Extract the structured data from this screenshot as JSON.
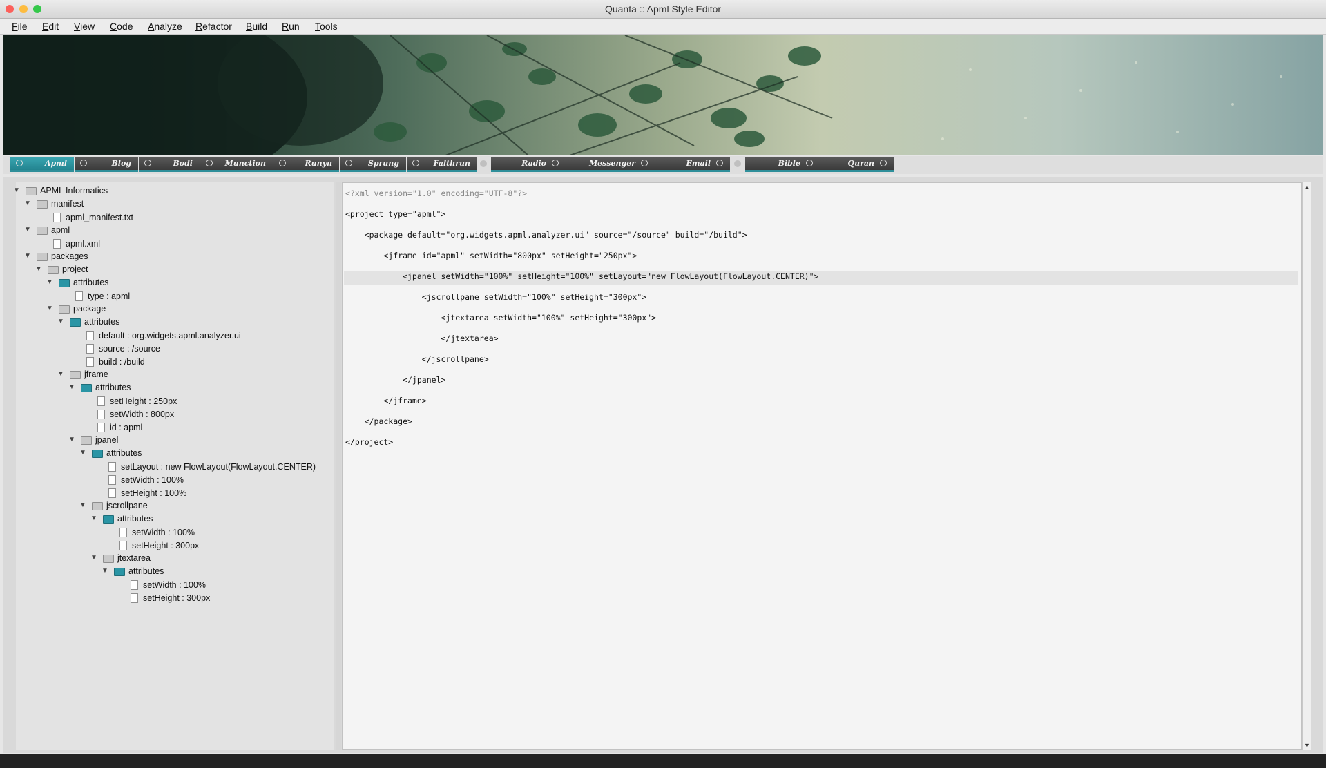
{
  "window": {
    "title": "Quanta :: Apml Style Editor",
    "traffic_lights": {
      "close": "#fc605b",
      "minimize": "#fdbc40",
      "zoom": "#34c84a"
    }
  },
  "menubar": {
    "items": [
      {
        "id": "file",
        "mnemonic": "F",
        "rest": "ile"
      },
      {
        "id": "edit",
        "mnemonic": "E",
        "rest": "dit"
      },
      {
        "id": "view",
        "mnemonic": "V",
        "rest": "iew"
      },
      {
        "id": "code",
        "mnemonic": "C",
        "rest": "ode"
      },
      {
        "id": "analyze",
        "mnemonic": "A",
        "rest": "nalyze"
      },
      {
        "id": "refactor",
        "mnemonic": "R",
        "rest": "efactor"
      },
      {
        "id": "build",
        "mnemonic": "B",
        "rest": "uild"
      },
      {
        "id": "run",
        "mnemonic": "R",
        "rest": "un"
      },
      {
        "id": "tools",
        "mnemonic": "T",
        "rest": "ools"
      }
    ]
  },
  "banner": {
    "image": "leaves-over-water-banner"
  },
  "tabs": [
    {
      "label": "Apml",
      "active": true
    },
    {
      "label": "Blog",
      "active": false
    },
    {
      "label": "Bodi",
      "active": false
    },
    {
      "label": "Munction",
      "active": false
    },
    {
      "label": "Runyn",
      "active": false
    },
    {
      "label": "Sprung",
      "active": false
    },
    {
      "label": "Falthrun",
      "active": false
    },
    {
      "label": "Radio",
      "active": false
    },
    {
      "label": "Messenger",
      "active": false
    },
    {
      "label": "Email",
      "active": false
    },
    {
      "label": "Bible",
      "active": false
    },
    {
      "label": "Quran",
      "active": false
    }
  ],
  "tree": {
    "root": "APML Informatics",
    "manifest": "manifest",
    "manifest_file": "apml_manifest.txt",
    "apml": "apml",
    "apml_file": "apml.xml",
    "packages": "packages",
    "project": "project",
    "attributes": "attributes",
    "project_type": "type : apml",
    "package": "package",
    "package_default": "default : org.widgets.apml.analyzer.ui",
    "package_source": "source : /source",
    "package_build": "build : /build",
    "jframe": "jframe",
    "jframe_height": "setHeight : 250px",
    "jframe_width": "setWidth : 800px",
    "jframe_id": "id : apml",
    "jpanel": "jpanel",
    "jpanel_layout": "setLayout : new FlowLayout(FlowLayout.CENTER)",
    "jpanel_width": "setWidth : 100%",
    "jpanel_height": "setHeight : 100%",
    "jscrollpane": "jscrollpane",
    "jscrollpane_width": "setWidth : 100%",
    "jscrollpane_height": "setHeight : 300px",
    "jtextarea": "jtextarea",
    "jtextarea_width": "setWidth : 100%",
    "jtextarea_height": "setHeight : 300px"
  },
  "editor": {
    "highlighted_line": 5,
    "lines": [
      "<?xml version=\"1.0\" encoding=\"UTF-8\"?>",
      "<project type=\"apml\">",
      "    <package default=\"org.widgets.apml.analyzer.ui\" source=\"/source\" build=\"/build\">",
      "        <jframe id=\"apml\" setWidth=\"800px\" setHeight=\"250px\">",
      "            <jpanel setWidth=\"100%\" setHeight=\"100%\" setLayout=\"new FlowLayout(FlowLayout.CENTER)\">",
      "                <jscrollpane setWidth=\"100%\" setHeight=\"300px\">",
      "                    <jtextarea setWidth=\"100%\" setHeight=\"300px\">",
      "                    </jtextarea>",
      "                </jscrollpane>",
      "            </jpanel>",
      "        </jframe>",
      "    </package>",
      "</project>"
    ]
  }
}
